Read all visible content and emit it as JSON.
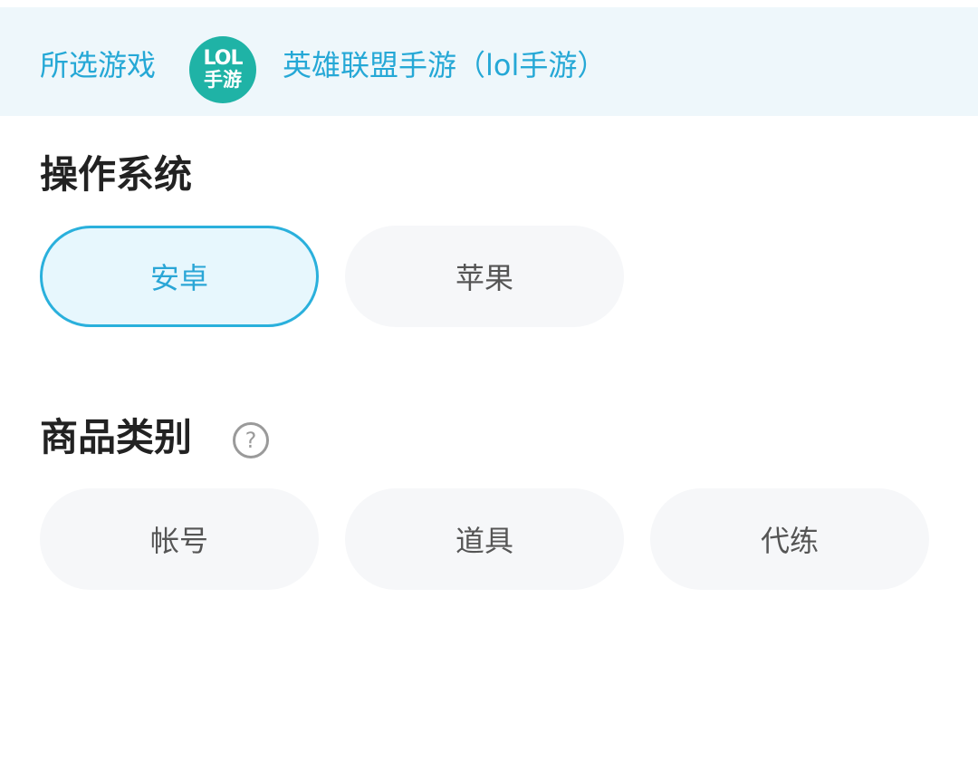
{
  "header": {
    "prefix_label": "所选游戏",
    "game_logo_text_line1": "LOL",
    "game_logo_text_line2": "手游",
    "game_name": "英雄联盟手游（lol手游）"
  },
  "os_section": {
    "title": "操作系统",
    "options": [
      {
        "label": "安卓",
        "selected": true
      },
      {
        "label": "苹果",
        "selected": false
      }
    ]
  },
  "category_section": {
    "title": "商品类别",
    "help_icon": "help-circle-icon",
    "help_glyph": "?",
    "options": [
      {
        "label": "帐号",
        "selected": false
      },
      {
        "label": "道具",
        "selected": false
      },
      {
        "label": "代练",
        "selected": false
      }
    ]
  },
  "colors": {
    "accent": "#25a8d6",
    "banner_bg": "#eef7fb",
    "selected_bg": "#e7f7fd",
    "chip_bg": "#f6f7f9",
    "logo_bg": "#1fb3a6"
  }
}
